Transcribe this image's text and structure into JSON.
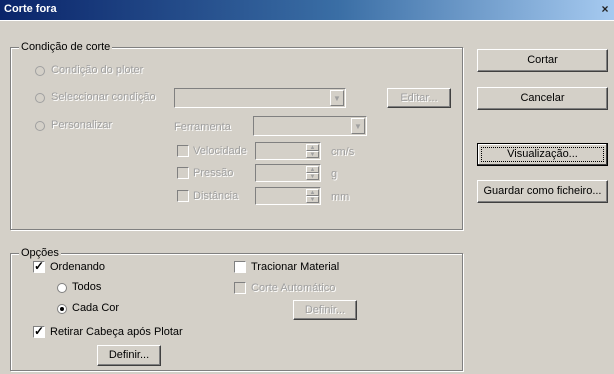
{
  "window": {
    "title": "Corte fora",
    "close_icon": "×"
  },
  "cut_condition": {
    "legend": "Condição de corte",
    "radio_plotter": "Condição do ploter",
    "radio_select": "Seleccionar condição",
    "radio_custom": "Personalizar",
    "select_condition_value": "",
    "edit_button": "Editar...",
    "tool_label": "Ferramenta",
    "tool_value": "",
    "speed_label": "Velocidade",
    "speed_value": "",
    "speed_unit": "cm/s",
    "pressure_label": "Pressão",
    "pressure_value": "",
    "pressure_unit": "g",
    "distance_label": "Distância",
    "distance_value": "",
    "distance_unit": "mm"
  },
  "options": {
    "legend": "Opções",
    "sorting_label": "Ordenando",
    "sorting_checked": true,
    "all_label": "Todos",
    "each_color_label": "Cada Cor",
    "selected_sort": "each_color",
    "retract_label": "Retirar Cabeça após Plotar",
    "retract_checked": true,
    "define_button": "Definir...",
    "tension_label": "Tracionar Material",
    "tension_checked": false,
    "auto_cut_label": "Corte Automático",
    "auto_cut_checked": false,
    "define_disabled_button": "Definir..."
  },
  "actions": {
    "cut": "Cortar",
    "cancel": "Cancelar",
    "preview": "Visualização...",
    "save_file": "Guardar como ficheiro..."
  }
}
